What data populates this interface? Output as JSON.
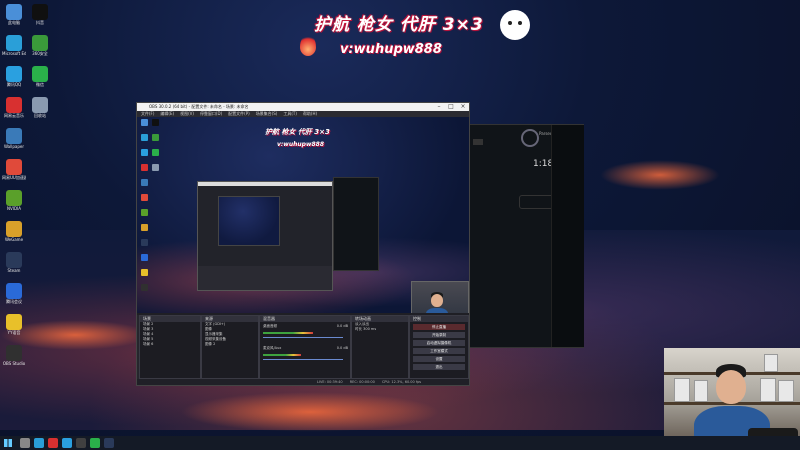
{
  "banner": {
    "headline": "护航 枪女 代肝 3×3",
    "contact": "v:wuhupw888"
  },
  "desktop_icons": [
    {
      "label": "此电脑",
      "color": "#4a8fd8"
    },
    {
      "label": "Microsoft Edge",
      "color": "#2a9fd8"
    },
    {
      "label": "腾讯QQ",
      "color": "#2aa0e0"
    },
    {
      "label": "网易云音乐",
      "color": "#d83030"
    },
    {
      "label": "Wallpaper",
      "color": "#3a7ab8"
    },
    {
      "label": "网易UU加速器",
      "color": "#e04a3a"
    },
    {
      "label": "NVIDIA",
      "color": "#5aa02a"
    },
    {
      "label": "WeGame",
      "color": "#d8a02a"
    },
    {
      "label": "Steam",
      "color": "#2a3a5a"
    },
    {
      "label": "腾讯会议",
      "color": "#2a6ad8"
    },
    {
      "label": "YY语音",
      "color": "#e8c02a"
    },
    {
      "label": "OBS Studio",
      "color": "#303030"
    },
    {
      "label": "抖音",
      "color": "#101010"
    },
    {
      "label": "360安全",
      "color": "#3a9a3a"
    },
    {
      "label": "微信",
      "color": "#2ab04a"
    },
    {
      "label": "回收站",
      "color": "#8a9ab0"
    }
  ],
  "obs": {
    "title": "OBS 30.0.2 (64 bit) - 配置文件: 未命名 - 场景: 未命名",
    "menu": [
      "文件(F)",
      "编辑(E)",
      "视图(V)",
      "停靠窗口(D)",
      "配置文件(P)",
      "场景集合(S)",
      "工具(T)",
      "帮助(H)"
    ],
    "banner_headline": "护航 枪女 代肝 3×3",
    "banner_contact": "v:wuhupw888",
    "panels": {
      "scenes": {
        "title": "场景",
        "items": [
          "场景 2",
          "场景 3",
          "场景 4",
          "场景 5",
          "场景 6"
        ]
      },
      "sources": {
        "title": "来源",
        "items": [
          "文字 (GDI+)",
          "图像",
          "显示器采集",
          "视频采集设备",
          "图像 2"
        ]
      },
      "mixer": {
        "title": "混音器",
        "tracks": [
          "桌面音频",
          "麦克风/Aux"
        ],
        "levels": [
          0.62,
          0.48
        ],
        "db": [
          "0.0 dB",
          "0.0 dB"
        ]
      },
      "transitions": {
        "title": "转场动画",
        "type": "淡入淡出",
        "duration_label": "时长",
        "duration": "300 ms"
      },
      "controls": {
        "title": "控制",
        "buttons": [
          "停止直播",
          "开始录制",
          "启动虚拟摄像机",
          "工作室模式",
          "设置",
          "退出"
        ]
      }
    },
    "status": {
      "live_label": "LIVE: 00:39:40",
      "rec_label": "REC: 00:00:00",
      "cpu": "CPU: 12.3%, 60.00 fps"
    }
  },
  "phone_app": {
    "time": "1:18",
    "title": "Parsec"
  },
  "taskbar": {
    "apps": [
      {
        "name": "start",
        "color": "#6cf"
      },
      {
        "name": "search",
        "color": "#888"
      },
      {
        "name": "edge",
        "color": "#2a9fd8"
      },
      {
        "name": "netease",
        "color": "#d83030"
      },
      {
        "name": "qq",
        "color": "#2aa0e0"
      },
      {
        "name": "obs",
        "color": "#404040"
      },
      {
        "name": "wechat",
        "color": "#2ab04a"
      },
      {
        "name": "steam",
        "color": "#2a3a5a"
      }
    ]
  }
}
